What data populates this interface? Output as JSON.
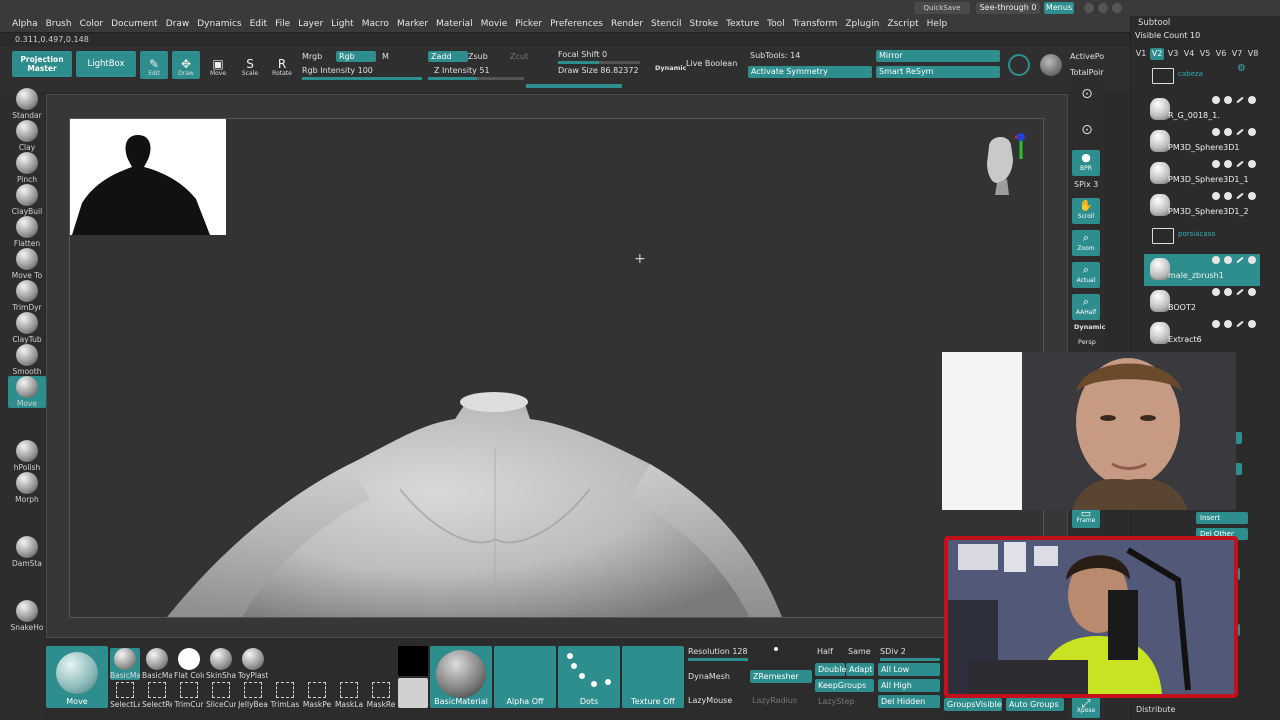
{
  "menu": [
    "Alpha",
    "Brush",
    "Color",
    "Document",
    "Draw",
    "Dynamics",
    "Edit",
    "File",
    "Layer",
    "Light",
    "Macro",
    "Marker",
    "Material",
    "Movie",
    "Picker",
    "Preferences",
    "Render",
    "Stencil",
    "Stroke",
    "Texture",
    "Tool",
    "Transform",
    "Zplugin",
    "Zscript",
    "Help"
  ],
  "title_right": {
    "quicksave": "QuickSave",
    "see_through": "See-through 0",
    "menus": "Menus"
  },
  "coords": "0.311,0.497,0.148",
  "toolbar": {
    "projection_master": "Projection Master",
    "lightbox": "LightBox",
    "tools": [
      {
        "label": "Edit",
        "icon": "edit-icon"
      },
      {
        "label": "Draw",
        "icon": "draw-icon"
      },
      {
        "label": "Move",
        "icon": "move-icon"
      },
      {
        "label": "Scale",
        "icon": "scale-icon"
      },
      {
        "label": "Rotate",
        "icon": "rotate-icon"
      }
    ],
    "mrgb": "Mrgb",
    "rgb": "Rgb",
    "m": "M",
    "rgb_intensity": "Rgb Intensity 100",
    "zadd": "Zadd",
    "zsub": "Zsub",
    "zcut": "Zcut",
    "z_intensity": "Z Intensity 51",
    "focal_shift": "Focal Shift 0",
    "draw_size": "Draw Size 86.82372",
    "dynamic": "Dynamic",
    "live_boolean": "Live Boolean",
    "subtools": "SubTools: 14",
    "activate_symmetry": "Activate Symmetry",
    "mirror": "Mirror",
    "smart_resym": "Smart ReSym",
    "active_points": "ActivePo",
    "total_points": "TotalPoir"
  },
  "left_brushes": [
    "Standar",
    "Clay",
    "Pinch",
    "ClayBuil",
    "Flatten",
    "Move To",
    "TrimDyr",
    "ClayTub",
    "Smooth",
    "Move",
    "hPolish",
    "Morph",
    "DamSta",
    "SnakeHo"
  ],
  "right_tray": [
    {
      "label": "",
      "icon": "s-icon"
    },
    {
      "label": "",
      "icon": "d-icon"
    },
    {
      "label": "BPR",
      "icon": "bpr-icon"
    },
    {
      "label": "SPix 3",
      "icon": ""
    },
    {
      "label": "Scroll",
      "icon": "hand-icon"
    },
    {
      "label": "Zoom",
      "icon": "zoom-icon"
    },
    {
      "label": "Actual",
      "icon": "actual-icon"
    },
    {
      "label": "AAHalf",
      "icon": "aahalf-icon"
    },
    {
      "label": "Dynamic",
      "icon": ""
    },
    {
      "label": "Persp",
      "icon": ""
    },
    {
      "label": "Frame",
      "icon": "frame-icon"
    },
    {
      "label": "Xpose",
      "icon": "xpose-icon"
    }
  ],
  "subtool": {
    "title": "Subtool",
    "visible_count": "Visible Count 10",
    "tabs": [
      "V1",
      "V2",
      "V3",
      "V4",
      "V5",
      "V6",
      "V7",
      "V8"
    ],
    "items": [
      {
        "name": "",
        "folder": "cabeza",
        "type": "folder"
      },
      {
        "name": "R_G_0018_1.",
        "type": "item"
      },
      {
        "name": "PM3D_Sphere3D1",
        "type": "item"
      },
      {
        "name": "PM3D_Sphere3D1_1",
        "type": "item"
      },
      {
        "name": "PM3D_Sphere3D1_2",
        "type": "item"
      },
      {
        "name": "",
        "folder": "porsiacaso",
        "type": "folder"
      },
      {
        "name": "male_zbrush1",
        "type": "item",
        "selected": true
      },
      {
        "name": "BOOT2",
        "type": "item"
      },
      {
        "name": "Extract6",
        "type": "item"
      }
    ],
    "side_buttons": [
      "der",
      "get",
      "Insert",
      "Del Other",
      "tools",
      "lar"
    ],
    "distribute": "Distribute"
  },
  "bottom": {
    "move_tile": "Move",
    "brushes": [
      "BasicMa",
      "BasicMa",
      "Flat Colo",
      "SkinSha",
      "ToyPlast"
    ],
    "tools": [
      "SelectLa",
      "SelectRe",
      "TrimCur",
      "SliceCur",
      "JellyBea",
      "TrimLas",
      "MaskPe",
      "MaskLa",
      "MaskRe"
    ],
    "material": "BasicMaterial",
    "alpha": "Alpha Off",
    "dots": "Dots",
    "texture": "Texture Off",
    "resolution": "Resolution 128",
    "dynamesh": "DynaMesh",
    "lazymouse": "LazyMouse",
    "lazyradius": "LazyRadius",
    "lazystep": "LazyStep",
    "zremesher": "ZRemesher",
    "half": "Half",
    "same": "Same",
    "double": "Double",
    "adapt": "Adapt",
    "keepgroups": "KeepGroups",
    "sdiv": "SDiv 2",
    "all_low": "All Low",
    "all_high": "All High",
    "del_hidden": "Del Hidden",
    "groupsvisible": "GroupsVisible",
    "auto_groups": "Auto Groups"
  },
  "colors": {
    "accent": "#2e8d8d",
    "bg": "#2a2a2a",
    "webcam_border": "#c4101a"
  }
}
